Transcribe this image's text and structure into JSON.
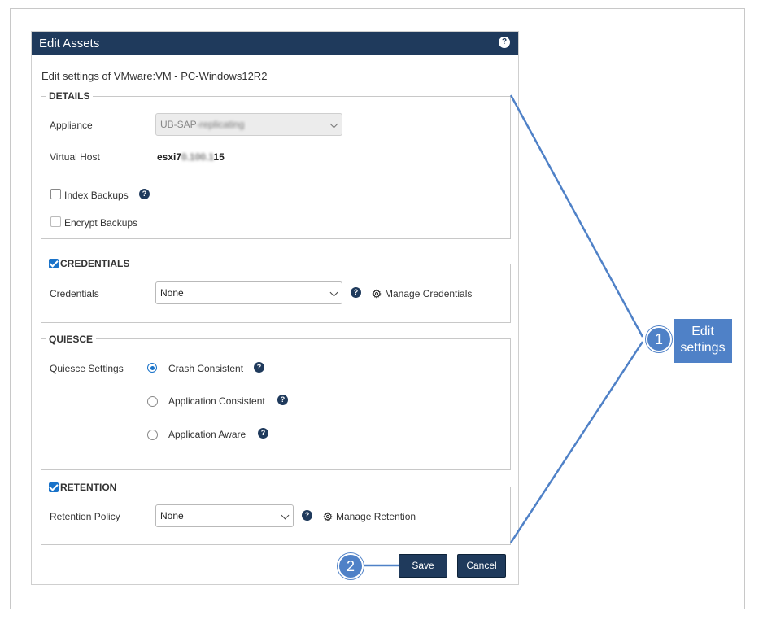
{
  "dialog": {
    "title": "Edit Assets",
    "help_glyph": "?",
    "subtitle": "Edit settings of VMware:VM - PC-Windows12R2"
  },
  "details": {
    "legend": "DETAILS",
    "appliance_label": "Appliance",
    "appliance_value_prefix": "UB-SAP",
    "appliance_value_blurred": "-replicating",
    "virtual_host_label": "Virtual Host",
    "virtual_host_prefix": "esxi7",
    "virtual_host_blurred": "0.100.1",
    "virtual_host_suffix": "15",
    "index_backups_label": "Index Backups",
    "encrypt_backups_label": "Encrypt Backups"
  },
  "credentials": {
    "legend": "CREDENTIALS",
    "label": "Credentials",
    "selected": "None",
    "manage_label": "Manage Credentials"
  },
  "quiesce": {
    "legend": "QUIESCE",
    "label": "Quiesce Settings",
    "options": [
      "Crash Consistent",
      "Application Consistent",
      "Application Aware"
    ],
    "selected": "Crash Consistent"
  },
  "retention": {
    "legend": "RETENTION",
    "label": "Retention Policy",
    "selected": "None",
    "manage_label": "Manage Retention"
  },
  "buttons": {
    "save": "Save",
    "cancel": "Cancel"
  },
  "callouts": {
    "one_number": "1",
    "one_text_line1": "Edit",
    "one_text_line2": "settings",
    "two_number": "2"
  },
  "colors": {
    "header": "#1f3a5c",
    "accent": "#1a73c9",
    "callout": "#4f81c7"
  }
}
